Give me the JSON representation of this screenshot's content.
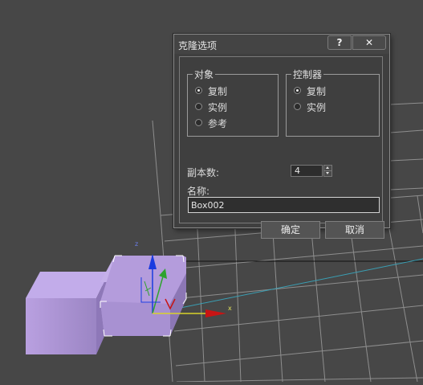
{
  "dialog": {
    "title": "克隆选项",
    "help_label": "?",
    "close_label": "✕",
    "object_group": {
      "legend": "对象",
      "options": [
        {
          "label": "复制",
          "selected": true
        },
        {
          "label": "实例",
          "selected": false
        },
        {
          "label": "参考",
          "selected": false
        }
      ]
    },
    "controller_group": {
      "legend": "控制器",
      "options": [
        {
          "label": "复制",
          "selected": true
        },
        {
          "label": "实例",
          "selected": false
        }
      ]
    },
    "copies_label": "副本数:",
    "copies_value": "4",
    "name_label": "名称:",
    "name_value": "Box002",
    "ok_label": "确定",
    "cancel_label": "取消"
  },
  "viewport": {
    "axis_z_label": "z",
    "axis_x_label": "x",
    "axis_colors": {
      "x": "#c81414",
      "y": "#2ea32e",
      "z": "#1a3be0"
    },
    "box_color": "#b29ad6",
    "grid_color": "#8e8e8e"
  }
}
